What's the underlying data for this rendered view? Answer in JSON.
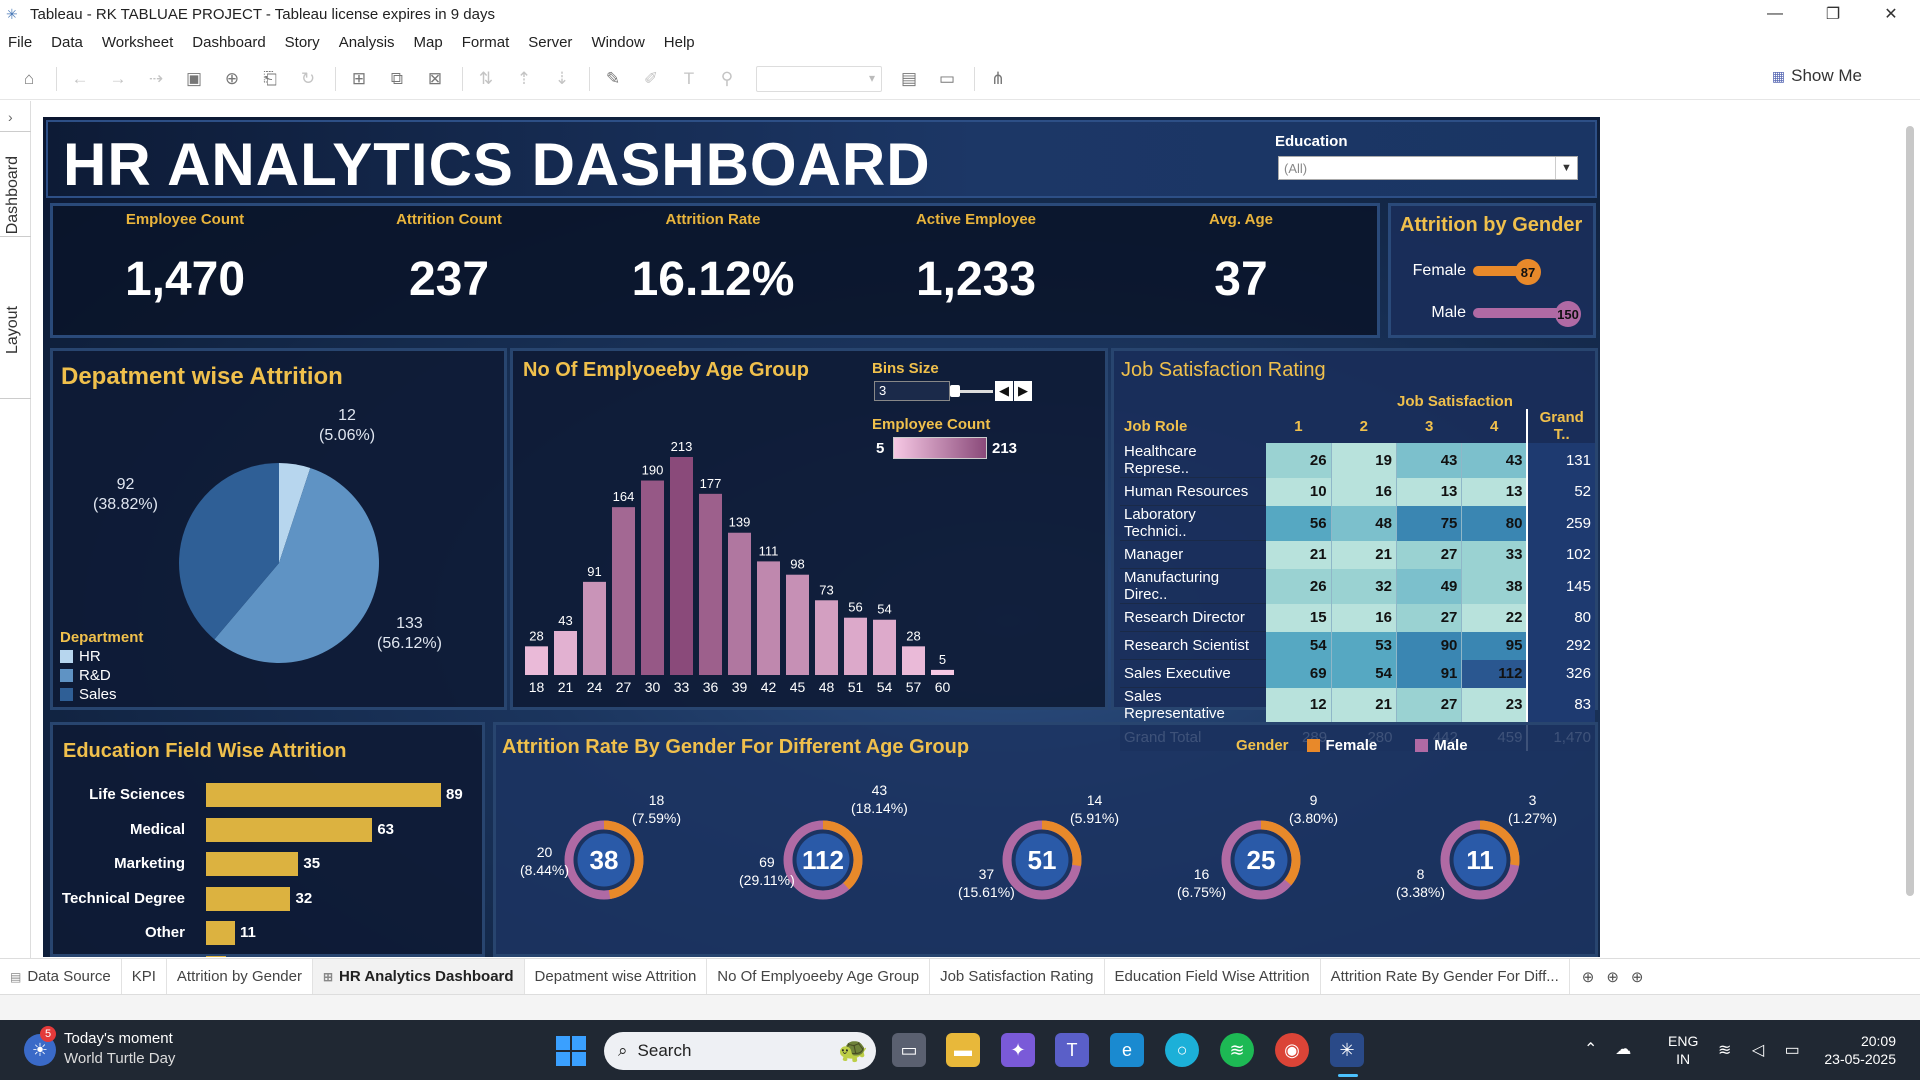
{
  "window": {
    "title": "Tableau - RK TABLUAE PROJECT - Tableau license expires in 9 days",
    "min": "—",
    "max": "❐",
    "close": "✕"
  },
  "menu": [
    "File",
    "Data",
    "Worksheet",
    "Dashboard",
    "Story",
    "Analysis",
    "Map",
    "Format",
    "Server",
    "Window",
    "Help"
  ],
  "toolbar": {
    "show_me": "Show Me"
  },
  "side_tabs": {
    "dashboard": "Dashboard",
    "layout": "Layout"
  },
  "dashboard": {
    "title": "HR ANALYTICS DASHBOARD",
    "education_filter": {
      "label": "Education",
      "value": "(All)"
    },
    "kpis": [
      {
        "label": "Employee Count",
        "value": "1,470"
      },
      {
        "label": "Attrition Count",
        "value": "237"
      },
      {
        "label": "Attrition Rate",
        "value": "16.12%"
      },
      {
        "label": "Active Employee",
        "value": "1,233"
      },
      {
        "label": "Avg. Age",
        "value": "37"
      }
    ],
    "attrition_by_gender": {
      "title": "Attrition by Gender",
      "rows": [
        {
          "label": "Female",
          "value": "87",
          "color": "#e8892a"
        },
        {
          "label": "Male",
          "value": "150",
          "color": "#b06aa4"
        }
      ]
    },
    "dept_attrition": {
      "title": "Depatment wise Attrition",
      "legend_title": "Department",
      "slices": [
        {
          "name": "HR",
          "value": 12,
          "pct": "(5.06%)",
          "color": "#b7d6ee"
        },
        {
          "name": "R&D",
          "value": 133,
          "pct": "(56.12%)",
          "color": "#5f93c4"
        },
        {
          "name": "Sales",
          "value": 92,
          "pct": "(38.82%)",
          "color": "#2f5f96"
        }
      ],
      "labels": {
        "hr": {
          "value": "12",
          "pct": "(5.06%)"
        },
        "rd": {
          "value": "133",
          "pct": "(56.12%)"
        },
        "sales": {
          "value": "92",
          "pct": "(38.82%)"
        }
      }
    },
    "age_group": {
      "title": "No Of Emplyoeeby Age Group",
      "bins_label": "Bins Size",
      "bins_value": "3",
      "color_legend_label": "Employee Count",
      "color_min": "5",
      "color_max": "213"
    },
    "job_satisfaction": {
      "title": "Job Satisfaction Rating",
      "col_group": "Job Satisfaction",
      "row_header": "Job Role",
      "columns": [
        "1",
        "2",
        "3",
        "4",
        "Grand T.."
      ],
      "rows": [
        {
          "role": "Healthcare Represe..",
          "v": [
            "26",
            "19",
            "43",
            "43"
          ],
          "total": "131"
        },
        {
          "role": "Human Resources",
          "v": [
            "10",
            "16",
            "13",
            "13"
          ],
          "total": "52"
        },
        {
          "role": "Laboratory Technici..",
          "v": [
            "56",
            "48",
            "75",
            "80"
          ],
          "total": "259"
        },
        {
          "role": "Manager",
          "v": [
            "21",
            "21",
            "27",
            "33"
          ],
          "total": "102"
        },
        {
          "role": "Manufacturing Direc..",
          "v": [
            "26",
            "32",
            "49",
            "38"
          ],
          "total": "145"
        },
        {
          "role": "Research Director",
          "v": [
            "15",
            "16",
            "27",
            "22"
          ],
          "total": "80"
        },
        {
          "role": "Research Scientist",
          "v": [
            "54",
            "53",
            "90",
            "95"
          ],
          "total": "292"
        },
        {
          "role": "Sales Executive",
          "v": [
            "69",
            "54",
            "91",
            "112"
          ],
          "total": "326"
        },
        {
          "role": "Sales Representative",
          "v": [
            "12",
            "21",
            "27",
            "23"
          ],
          "total": "83"
        }
      ],
      "grand_total": {
        "label": "Grand Total",
        "v": [
          "289",
          "280",
          "442",
          "459"
        ],
        "total": "1,470"
      }
    },
    "edu_field": {
      "title": "Education Field Wise Attrition",
      "rows": [
        {
          "label": "Life Sciences",
          "value": 89,
          "text": "89"
        },
        {
          "label": "Medical",
          "value": 63,
          "text": "63"
        },
        {
          "label": "Marketing",
          "value": 35,
          "text": "35"
        },
        {
          "label": "Technical Degree",
          "value": 32,
          "text": "32"
        },
        {
          "label": "Other",
          "value": 11,
          "text": "11"
        }
      ]
    },
    "age_gender": {
      "title": "Attrition Rate By Gender For Different Age Group",
      "legend_title": "Gender",
      "legend": [
        {
          "label": "Female",
          "color": "#e8892a"
        },
        {
          "label": "Male",
          "color": "#b06aa4"
        }
      ],
      "donuts": [
        {
          "total": "38",
          "female": 18,
          "female_txt": "18\n(7.59%)",
          "male": 20,
          "male_txt": "20\n(8.44%)"
        },
        {
          "total": "112",
          "female": 43,
          "female_txt": "43\n(18.14%)",
          "male": 69,
          "male_txt": "69\n(29.11%)"
        },
        {
          "total": "51",
          "female": 14,
          "female_txt": "14\n(5.91%)",
          "male": 37,
          "male_txt": "37\n(15.61%)"
        },
        {
          "total": "25",
          "female": 9,
          "female_txt": "9\n(3.80%)",
          "male": 16,
          "male_txt": "16\n(6.75%)"
        },
        {
          "total": "11",
          "female": 3,
          "female_txt": "3\n(1.27%)",
          "male": 8,
          "male_txt": "8\n(3.38%)"
        }
      ]
    }
  },
  "chart_data": {
    "type": "bar",
    "title": "No Of Emplyoeeby Age Group",
    "categories": [
      "18",
      "21",
      "24",
      "27",
      "30",
      "33",
      "36",
      "39",
      "42",
      "45",
      "48",
      "51",
      "54",
      "57",
      "60"
    ],
    "values": [
      28,
      43,
      91,
      164,
      190,
      213,
      177,
      139,
      111,
      98,
      73,
      56,
      54,
      28,
      5
    ],
    "ylim": [
      0,
      213
    ]
  },
  "sheet_tabs": [
    "Data Source",
    "KPI",
    "Attrition by Gender",
    "HR Analytics  Dashboard",
    "Depatment wise Attrition",
    "No Of Emplyoeeby Age Group",
    "Job Satisfaction Rating",
    "Education Field Wise Attrition",
    "Attrition Rate By Gender For Diff..."
  ],
  "active_tab": "HR Analytics  Dashboard",
  "taskbar": {
    "news_title": "Today's moment",
    "news_sub": "World Turtle Day",
    "badge": "5",
    "search": "Search",
    "lang1": "ENG",
    "lang2": "IN",
    "time": "20:09",
    "date": "23-05-2025"
  }
}
